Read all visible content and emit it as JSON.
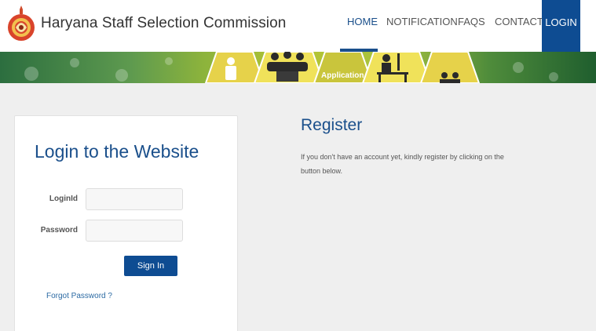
{
  "header": {
    "title": "Haryana Staff Selection Commission",
    "logo_icon": "state-emblem-icon",
    "nav": {
      "home": "HOME",
      "notification": "NOTIFICATION",
      "faqs": "FAQS",
      "contact": "CONTACT",
      "login": "LOGIN"
    }
  },
  "banner": {
    "label": "Application",
    "icons": [
      "person-icon",
      "group-meeting-icon",
      "desk-work-icon",
      "people-icon"
    ]
  },
  "login": {
    "heading": "Login to the Website",
    "loginid_label": "LoginId",
    "loginid_value": "",
    "password_label": "Password",
    "password_value": "",
    "signin_label": "Sign In",
    "forgot_label": "Forgot Password ?"
  },
  "register": {
    "heading": "Register",
    "text": "If you don't have an account yet, kindly register by clicking on the button below."
  },
  "colors": {
    "primary": "#0e4c92",
    "heading": "#1a4f8b",
    "background": "#efefef"
  }
}
